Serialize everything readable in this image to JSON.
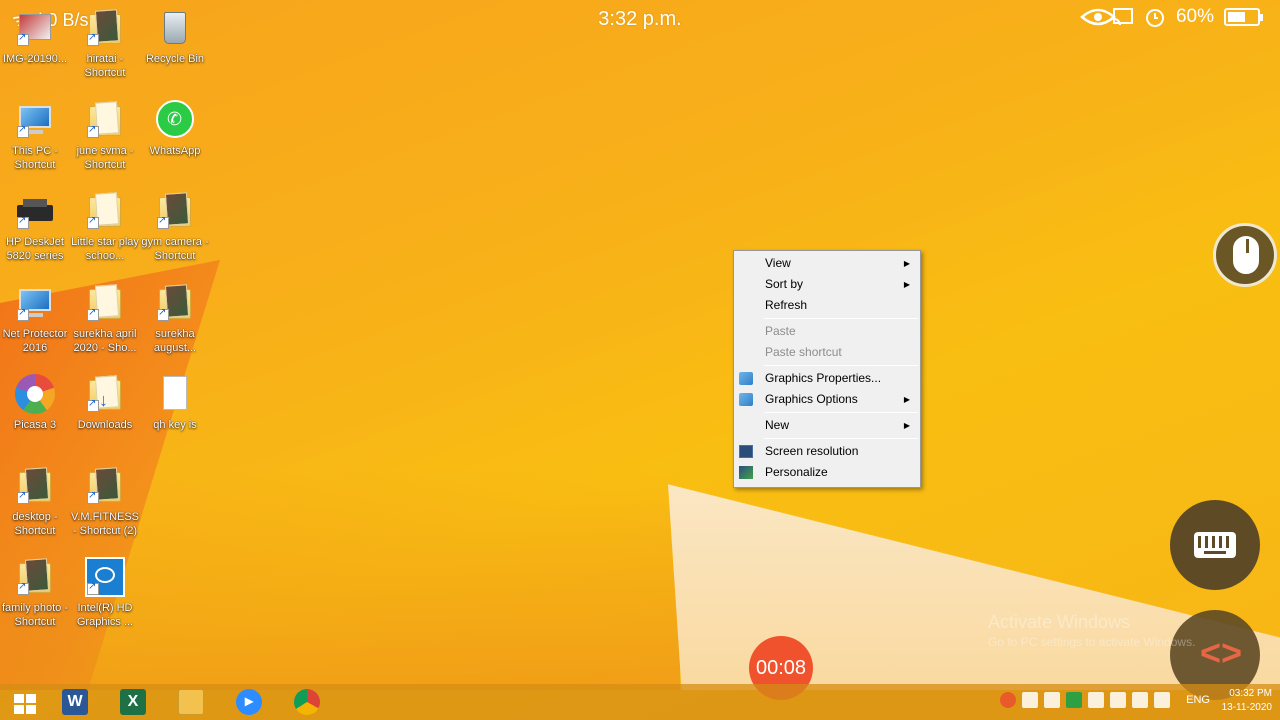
{
  "status_bar": {
    "left_text": "ᯤ.ıl 0 B/s",
    "time": "3:32 p.m.",
    "battery": "60%",
    "battery_level": 0.6
  },
  "desktop_icons": [
    {
      "label": "IMG-20190..."
    },
    {
      "label": "hiratai - Shortcut"
    },
    {
      "label": "Recycle Bin"
    },
    {
      "label": "This PC - Shortcut"
    },
    {
      "label": "june svma - Shortcut"
    },
    {
      "label": "WhatsApp"
    },
    {
      "label": "HP DeskJet 5820 series"
    },
    {
      "label": "Little star play schoo..."
    },
    {
      "label": "gym camera - Shortcut"
    },
    {
      "label": "Net Protector 2016"
    },
    {
      "label": "surekha april 2020 - Sho..."
    },
    {
      "label": "surekha august..."
    },
    {
      "label": "Picasa 3"
    },
    {
      "label": "Downloads"
    },
    {
      "label": "qh key is"
    },
    {
      "label": "desktop - Shortcut"
    },
    {
      "label": "V.M.FITNESS - Shortcut (2)"
    },
    {
      "label": "family photo - Shortcut"
    },
    {
      "label": "Intel(R) HD Graphics ..."
    }
  ],
  "context_menu": {
    "view": "View",
    "sort_by": "Sort by",
    "refresh": "Refresh",
    "paste": "Paste",
    "paste_shortcut": "Paste shortcut",
    "graphics_properties": "Graphics Properties...",
    "graphics_options": "Graphics Options",
    "new": "New",
    "screen_resolution": "Screen resolution",
    "personalize": "Personalize"
  },
  "recording_timer": "00:08",
  "watermark": {
    "title": "Activate Windows",
    "subtitle": "Go to PC settings to activate Windows."
  },
  "taskbar": {
    "apps": [
      "start",
      "word",
      "excel",
      "file-explorer",
      "zoom",
      "chrome"
    ],
    "language": "ENG",
    "clock_time": "03:32 PM",
    "clock_date": "13-11-2020"
  }
}
